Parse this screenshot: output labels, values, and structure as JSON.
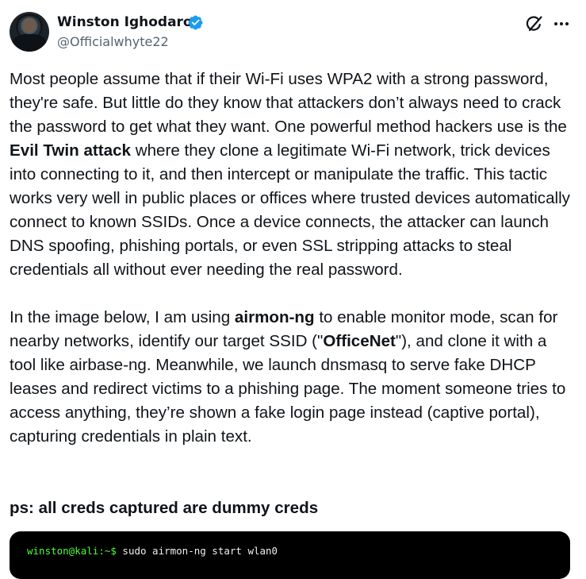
{
  "author": {
    "display_name": "Winston Ighodaro",
    "handle": "@Officialwhyte22",
    "verified": true
  },
  "icons": {
    "verified": "verified-badge-icon",
    "grok": "grok-icon",
    "more": "more-options-icon"
  },
  "colors": {
    "text": "#0f1419",
    "secondary_text": "#536471",
    "verified_blue": "#1d9bf0",
    "terminal_bg": "#000000",
    "terminal_prompt": "#4dff3a",
    "terminal_text": "#f0f0f0"
  },
  "tweet": {
    "para1": {
      "part1": "Most people assume that if their Wi-Fi uses WPA2 with a strong password, they're safe. But little do they know that attackers don’t always need to crack the password to get what they want. One powerful method hackers use is the ",
      "bold1": "Evil Twin attack",
      "part2": " where they clone a legitimate Wi-Fi network, trick devices into connecting to it, and then intercept or manipulate the traffic. This tactic works very well in public places or offices where trusted devices automatically connect to known SSIDs. Once a device connects, the attacker can launch DNS spoofing, phishing portals, or even SSL stripping attacks to steal credentials all without ever needing the real password."
    },
    "para2": {
      "part1": "In the image below, I am using ",
      "bold1": "airmon-ng",
      "part2": " to enable monitor mode, scan for nearby networks, identify our target SSID (\"",
      "bold2": "OfficeNet",
      "part3": "\"), and clone it with a tool like airbase-ng. Meanwhile, we launch dnsmasq to serve fake DHCP leases and redirect victims to a phishing page. The moment someone tries to access anything, they’re shown a fake login page instead (captive portal), capturing credentials in plain text."
    },
    "ps": "ps: all creds captured are dummy creds"
  },
  "terminal": {
    "prompt": "winston@kali:~$",
    "command": " sudo airmon-ng start wlan0"
  }
}
